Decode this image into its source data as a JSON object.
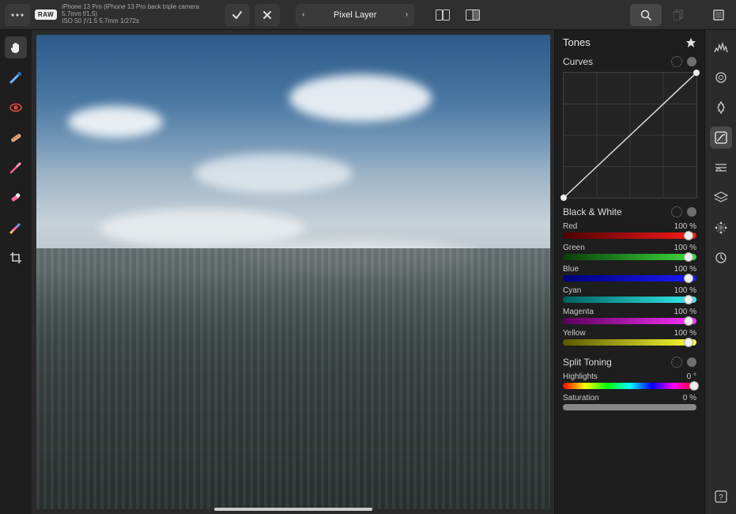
{
  "topbar": {
    "raw_badge": "RAW",
    "meta_line1": "iPhone 13 Pro (iPhone 13 Pro back triple camera 5.7mm f/1.5)",
    "meta_line2": "ISO 50 ƒ/1.5 5.7mm 1/272s",
    "layer_label": "Pixel Layer"
  },
  "panel": {
    "title": "Tones",
    "sections": {
      "curves": {
        "title": "Curves"
      },
      "bw": {
        "title": "Black & White",
        "sliders": [
          {
            "label": "Red",
            "value": "100 %",
            "pos": 94,
            "fill": "linear-gradient(to right, #4d0000, #ff1a1a)"
          },
          {
            "label": "Green",
            "value": "100 %",
            "pos": 94,
            "fill": "linear-gradient(to right, #0b3d0b, #3bdf3b)"
          },
          {
            "label": "Blue",
            "value": "100 %",
            "pos": 94,
            "fill": "linear-gradient(to right, #00007a, #1a1aff)"
          },
          {
            "label": "Cyan",
            "value": "100 %",
            "pos": 94,
            "fill": "linear-gradient(to right, #006060, #33f0f0)"
          },
          {
            "label": "Magenta",
            "value": "100 %",
            "pos": 94,
            "fill": "linear-gradient(to right, #5a005a, #ff33ff)"
          },
          {
            "label": "Yellow",
            "value": "100 %",
            "pos": 94,
            "fill": "linear-gradient(to right, #5a5a00, #ffff33)"
          }
        ]
      },
      "split": {
        "title": "Split Toning",
        "highlights_label": "Highlights",
        "highlights_value": "0 °",
        "saturation_label": "Saturation",
        "saturation_value": "0 %"
      }
    }
  }
}
